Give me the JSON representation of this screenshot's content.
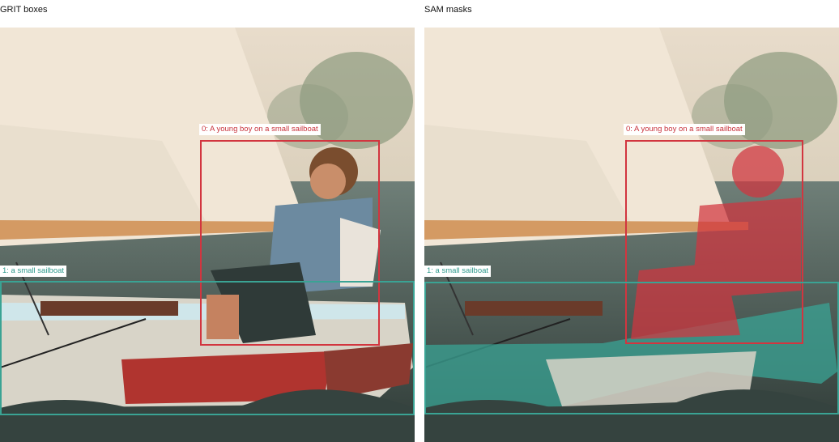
{
  "panels": [
    {
      "title": "GRIT boxes",
      "mode": "boxes"
    },
    {
      "title": "SAM masks",
      "mode": "masks"
    }
  ],
  "detections": [
    {
      "label": "0: A young boy on a small sailboat",
      "color": "#d2353f"
    },
    {
      "label": "1: a small sailboat",
      "color": "#3aa394"
    }
  ]
}
